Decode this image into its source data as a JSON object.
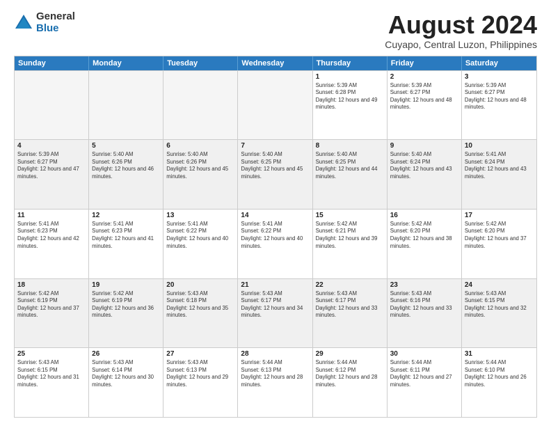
{
  "logo": {
    "general": "General",
    "blue": "Blue"
  },
  "title": "August 2024",
  "subtitle": "Cuyapo, Central Luzon, Philippines",
  "headers": [
    "Sunday",
    "Monday",
    "Tuesday",
    "Wednesday",
    "Thursday",
    "Friday",
    "Saturday"
  ],
  "weeks": [
    [
      {
        "day": "",
        "empty": true
      },
      {
        "day": "",
        "empty": true
      },
      {
        "day": "",
        "empty": true
      },
      {
        "day": "",
        "empty": true
      },
      {
        "day": "1",
        "sunrise": "Sunrise: 5:39 AM",
        "sunset": "Sunset: 6:28 PM",
        "daylight": "Daylight: 12 hours and 49 minutes."
      },
      {
        "day": "2",
        "sunrise": "Sunrise: 5:39 AM",
        "sunset": "Sunset: 6:27 PM",
        "daylight": "Daylight: 12 hours and 48 minutes."
      },
      {
        "day": "3",
        "sunrise": "Sunrise: 5:39 AM",
        "sunset": "Sunset: 6:27 PM",
        "daylight": "Daylight: 12 hours and 48 minutes."
      }
    ],
    [
      {
        "day": "4",
        "sunrise": "Sunrise: 5:39 AM",
        "sunset": "Sunset: 6:27 PM",
        "daylight": "Daylight: 12 hours and 47 minutes."
      },
      {
        "day": "5",
        "sunrise": "Sunrise: 5:40 AM",
        "sunset": "Sunset: 6:26 PM",
        "daylight": "Daylight: 12 hours and 46 minutes."
      },
      {
        "day": "6",
        "sunrise": "Sunrise: 5:40 AM",
        "sunset": "Sunset: 6:26 PM",
        "daylight": "Daylight: 12 hours and 45 minutes."
      },
      {
        "day": "7",
        "sunrise": "Sunrise: 5:40 AM",
        "sunset": "Sunset: 6:25 PM",
        "daylight": "Daylight: 12 hours and 45 minutes."
      },
      {
        "day": "8",
        "sunrise": "Sunrise: 5:40 AM",
        "sunset": "Sunset: 6:25 PM",
        "daylight": "Daylight: 12 hours and 44 minutes."
      },
      {
        "day": "9",
        "sunrise": "Sunrise: 5:40 AM",
        "sunset": "Sunset: 6:24 PM",
        "daylight": "Daylight: 12 hours and 43 minutes."
      },
      {
        "day": "10",
        "sunrise": "Sunrise: 5:41 AM",
        "sunset": "Sunset: 6:24 PM",
        "daylight": "Daylight: 12 hours and 43 minutes."
      }
    ],
    [
      {
        "day": "11",
        "sunrise": "Sunrise: 5:41 AM",
        "sunset": "Sunset: 6:23 PM",
        "daylight": "Daylight: 12 hours and 42 minutes."
      },
      {
        "day": "12",
        "sunrise": "Sunrise: 5:41 AM",
        "sunset": "Sunset: 6:23 PM",
        "daylight": "Daylight: 12 hours and 41 minutes."
      },
      {
        "day": "13",
        "sunrise": "Sunrise: 5:41 AM",
        "sunset": "Sunset: 6:22 PM",
        "daylight": "Daylight: 12 hours and 40 minutes."
      },
      {
        "day": "14",
        "sunrise": "Sunrise: 5:41 AM",
        "sunset": "Sunset: 6:22 PM",
        "daylight": "Daylight: 12 hours and 40 minutes."
      },
      {
        "day": "15",
        "sunrise": "Sunrise: 5:42 AM",
        "sunset": "Sunset: 6:21 PM",
        "daylight": "Daylight: 12 hours and 39 minutes."
      },
      {
        "day": "16",
        "sunrise": "Sunrise: 5:42 AM",
        "sunset": "Sunset: 6:20 PM",
        "daylight": "Daylight: 12 hours and 38 minutes."
      },
      {
        "day": "17",
        "sunrise": "Sunrise: 5:42 AM",
        "sunset": "Sunset: 6:20 PM",
        "daylight": "Daylight: 12 hours and 37 minutes."
      }
    ],
    [
      {
        "day": "18",
        "sunrise": "Sunrise: 5:42 AM",
        "sunset": "Sunset: 6:19 PM",
        "daylight": "Daylight: 12 hours and 37 minutes."
      },
      {
        "day": "19",
        "sunrise": "Sunrise: 5:42 AM",
        "sunset": "Sunset: 6:19 PM",
        "daylight": "Daylight: 12 hours and 36 minutes."
      },
      {
        "day": "20",
        "sunrise": "Sunrise: 5:43 AM",
        "sunset": "Sunset: 6:18 PM",
        "daylight": "Daylight: 12 hours and 35 minutes."
      },
      {
        "day": "21",
        "sunrise": "Sunrise: 5:43 AM",
        "sunset": "Sunset: 6:17 PM",
        "daylight": "Daylight: 12 hours and 34 minutes."
      },
      {
        "day": "22",
        "sunrise": "Sunrise: 5:43 AM",
        "sunset": "Sunset: 6:17 PM",
        "daylight": "Daylight: 12 hours and 33 minutes."
      },
      {
        "day": "23",
        "sunrise": "Sunrise: 5:43 AM",
        "sunset": "Sunset: 6:16 PM",
        "daylight": "Daylight: 12 hours and 33 minutes."
      },
      {
        "day": "24",
        "sunrise": "Sunrise: 5:43 AM",
        "sunset": "Sunset: 6:15 PM",
        "daylight": "Daylight: 12 hours and 32 minutes."
      }
    ],
    [
      {
        "day": "25",
        "sunrise": "Sunrise: 5:43 AM",
        "sunset": "Sunset: 6:15 PM",
        "daylight": "Daylight: 12 hours and 31 minutes."
      },
      {
        "day": "26",
        "sunrise": "Sunrise: 5:43 AM",
        "sunset": "Sunset: 6:14 PM",
        "daylight": "Daylight: 12 hours and 30 minutes."
      },
      {
        "day": "27",
        "sunrise": "Sunrise: 5:43 AM",
        "sunset": "Sunset: 6:13 PM",
        "daylight": "Daylight: 12 hours and 29 minutes."
      },
      {
        "day": "28",
        "sunrise": "Sunrise: 5:44 AM",
        "sunset": "Sunset: 6:13 PM",
        "daylight": "Daylight: 12 hours and 28 minutes."
      },
      {
        "day": "29",
        "sunrise": "Sunrise: 5:44 AM",
        "sunset": "Sunset: 6:12 PM",
        "daylight": "Daylight: 12 hours and 28 minutes."
      },
      {
        "day": "30",
        "sunrise": "Sunrise: 5:44 AM",
        "sunset": "Sunset: 6:11 PM",
        "daylight": "Daylight: 12 hours and 27 minutes."
      },
      {
        "day": "31",
        "sunrise": "Sunrise: 5:44 AM",
        "sunset": "Sunset: 6:10 PM",
        "daylight": "Daylight: 12 hours and 26 minutes."
      }
    ]
  ]
}
